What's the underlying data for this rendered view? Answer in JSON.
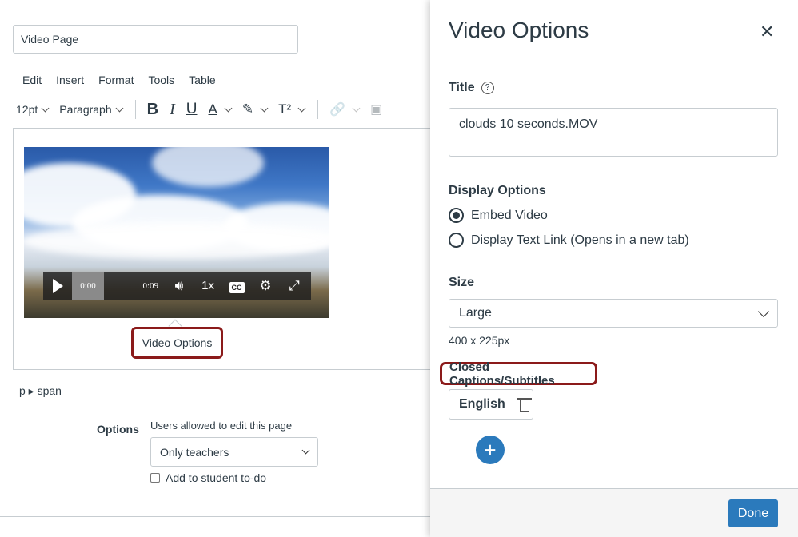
{
  "editor": {
    "page_title_value": "Video Page",
    "menu": [
      "Edit",
      "Insert",
      "Format",
      "Tools",
      "Table"
    ],
    "font_size": "12pt",
    "block_format": "Paragraph",
    "video": {
      "current_time": "0:00",
      "duration": "0:09",
      "speed": "1x",
      "cc_label": "CC"
    },
    "video_options_button": "Video Options",
    "element_path": "p ▸ span",
    "options_label": "Options",
    "permission_label": "Users allowed to edit this page",
    "permission_value": "Only teachers",
    "todo_label": "Add to student to-do"
  },
  "tray": {
    "title": "Video Options",
    "close_icon": "close-icon",
    "title_label": "Title",
    "title_value": "clouds 10 seconds.MOV",
    "display_options_label": "Display Options",
    "display_options": [
      {
        "label": "Embed Video",
        "checked": true
      },
      {
        "label": "Display Text Link (Opens in a new tab)",
        "checked": false
      }
    ],
    "size_label": "Size",
    "size_value": "Large",
    "size_dims": "400 x 225px",
    "captions_label": "Closed Captions/Subtitles",
    "caption_language": "English",
    "add_symbol": "+",
    "done_label": "Done"
  },
  "colors": {
    "primary": "#2b7abc",
    "highlight_border": "#8b1a1a",
    "text": "#2d3b45"
  }
}
